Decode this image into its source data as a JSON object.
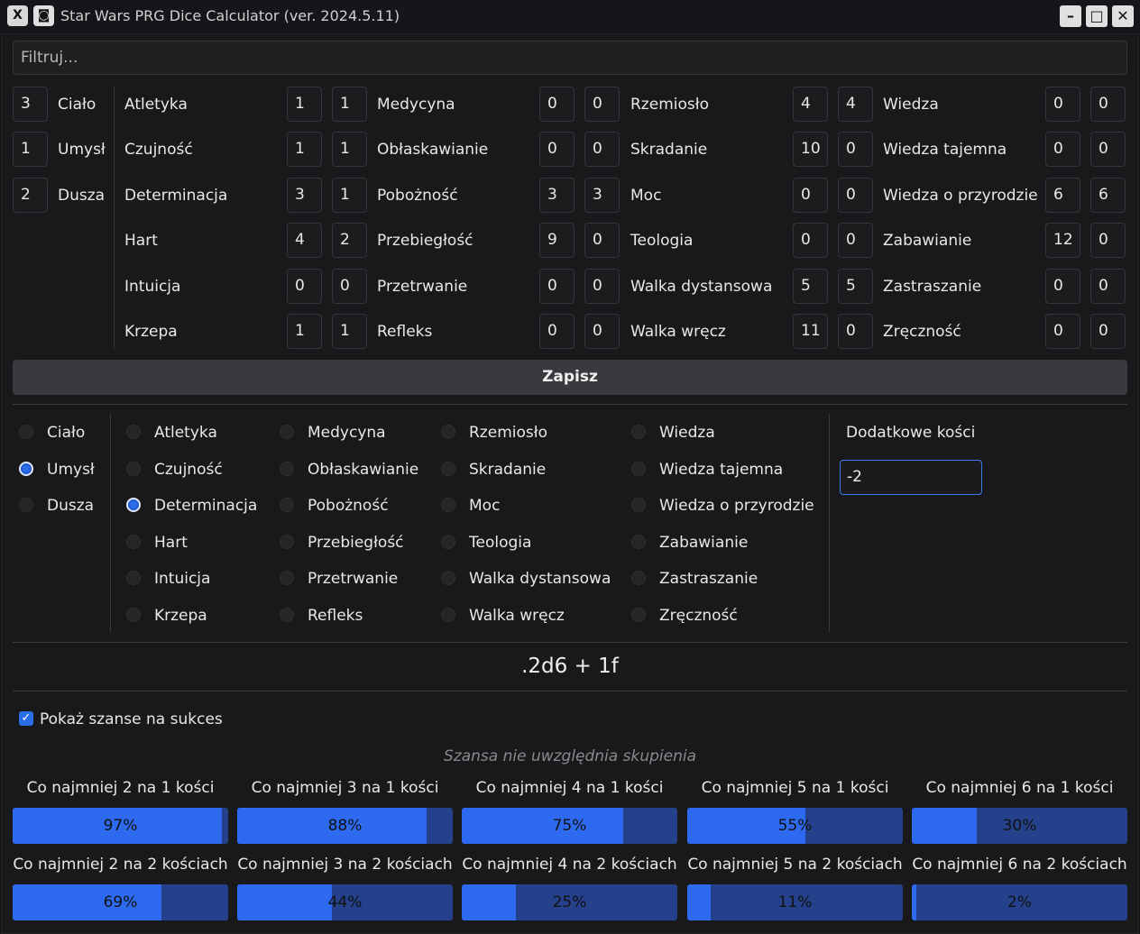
{
  "window": {
    "title": "Star Wars PRG Dice Calculator (ver. 2024.5.11)",
    "buttons": [
      "minimize",
      "maximize",
      "close"
    ]
  },
  "filter": {
    "placeholder": "Filtruj..."
  },
  "attributes": [
    {
      "value": "3",
      "label": "Ciało"
    },
    {
      "value": "1",
      "label": "Umysł"
    },
    {
      "value": "2",
      "label": "Dusza"
    }
  ],
  "skill_columns": [
    [
      {
        "label": "Atletyka",
        "a": "1",
        "b": "1"
      },
      {
        "label": "Czujność",
        "a": "1",
        "b": "1"
      },
      {
        "label": "Determinacja",
        "a": "3",
        "b": "1"
      },
      {
        "label": "Hart",
        "a": "4",
        "b": "2"
      },
      {
        "label": "Intuicja",
        "a": "0",
        "b": "0"
      },
      {
        "label": "Krzepa",
        "a": "1",
        "b": "1"
      }
    ],
    [
      {
        "label": "Medycyna",
        "a": "0",
        "b": "0"
      },
      {
        "label": "Obłaskawianie",
        "a": "0",
        "b": "0"
      },
      {
        "label": "Pobożność",
        "a": "3",
        "b": "3"
      },
      {
        "label": "Przebiegłość",
        "a": "9",
        "b": "0"
      },
      {
        "label": "Przetrwanie",
        "a": "0",
        "b": "0"
      },
      {
        "label": "Refleks",
        "a": "0",
        "b": "0"
      }
    ],
    [
      {
        "label": "Rzemiosło",
        "a": "4",
        "b": "4"
      },
      {
        "label": "Skradanie",
        "a": "10",
        "b": "0"
      },
      {
        "label": "Moc",
        "a": "0",
        "b": "0"
      },
      {
        "label": "Teologia",
        "a": "0",
        "b": "0"
      },
      {
        "label": "Walka dystansowa",
        "a": "5",
        "b": "5"
      },
      {
        "label": "Walka wręcz",
        "a": "11",
        "b": "0"
      }
    ],
    [
      {
        "label": "Wiedza",
        "a": "0",
        "b": "0"
      },
      {
        "label": "Wiedza tajemna",
        "a": "0",
        "b": "0"
      },
      {
        "label": "Wiedza o przyrodzie",
        "a": "6",
        "b": "6"
      },
      {
        "label": "Zabawianie",
        "a": "12",
        "b": "0"
      },
      {
        "label": "Zastraszanie",
        "a": "0",
        "b": "0"
      },
      {
        "label": "Zręczność",
        "a": "0",
        "b": "0"
      }
    ]
  ],
  "save_label": "Zapisz",
  "selected_attribute": "Umysł",
  "selected_skill": "Determinacja",
  "extra_dice": {
    "label": "Dodatkowe kości",
    "value": "-2"
  },
  "formula": ".2d6 + 1f",
  "show_chances": {
    "label": "Pokaż szanse na sukces",
    "checked": true
  },
  "note": "Szansa nie uwzględnia skupienia",
  "probabilities": [
    [
      {
        "title": "Co najmniej 2 na 1 kości",
        "text": "97%",
        "value": 0.97
      },
      {
        "title": "Co najmniej 3 na 1 kości",
        "text": "88%",
        "value": 0.88
      },
      {
        "title": "Co najmniej 4 na 1 kości",
        "text": "75%",
        "value": 0.75
      },
      {
        "title": "Co najmniej 5 na 1 kości",
        "text": "55%",
        "value": 0.55
      },
      {
        "title": "Co najmniej 6 na 1 kości",
        "text": "30%",
        "value": 0.3
      }
    ],
    [
      {
        "title": "Co najmniej 2 na 2 kościach",
        "text": "69%",
        "value": 0.69
      },
      {
        "title": "Co najmniej 3 na 2 kościach",
        "text": "44%",
        "value": 0.44
      },
      {
        "title": "Co najmniej 4 na 2 kościach",
        "text": "25%",
        "value": 0.25
      },
      {
        "title": "Co najmniej 5 na 2 kościach",
        "text": "11%",
        "value": 0.11
      },
      {
        "title": "Co najmniej 6 na 2 kościach",
        "text": "2%",
        "value": 0.02
      }
    ]
  ],
  "colors": {
    "accent": "#2d6af0",
    "bar_track": "#25418b",
    "background": "#19191c"
  }
}
